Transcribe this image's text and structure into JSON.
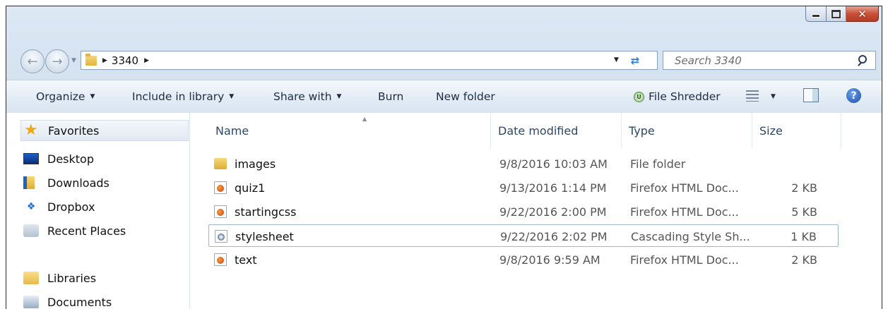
{
  "window": {
    "controls": {
      "minimize": "minimize",
      "maximize": "maximize",
      "close": "✕"
    }
  },
  "address": {
    "crumbs": [
      "3340"
    ],
    "search_placeholder": "Search 3340"
  },
  "toolbar": {
    "organize": "Organize",
    "include_in_library": "Include in library",
    "share_with": "Share with",
    "burn": "Burn",
    "new_folder": "New folder",
    "file_shredder": "File Shredder",
    "shredder_badge": "U"
  },
  "nav_pane": {
    "favorites": "Favorites",
    "items": [
      "Desktop",
      "Downloads",
      "Dropbox",
      "Recent Places"
    ],
    "libraries": "Libraries",
    "library_items": [
      "Documents"
    ]
  },
  "file_list": {
    "columns": {
      "name": "Name",
      "date": "Date modified",
      "type": "Type",
      "size": "Size"
    },
    "rows": [
      {
        "name": "images",
        "date": "9/8/2016 10:03 AM",
        "type": "File folder",
        "size": "",
        "icon": "folder-icon"
      },
      {
        "name": "quiz1",
        "date": "9/13/2016 1:14 PM",
        "type": "Firefox HTML Doc...",
        "size": "2 KB",
        "icon": "firefox-html-icon"
      },
      {
        "name": "startingcss",
        "date": "9/22/2016 2:00 PM",
        "type": "Firefox HTML Doc...",
        "size": "5 KB",
        "icon": "firefox-html-icon"
      },
      {
        "name": "stylesheet",
        "date": "9/22/2016 2:02 PM",
        "type": "Cascading Style Sh...",
        "size": "1 KB",
        "icon": "css-file-icon"
      },
      {
        "name": "text",
        "date": "9/8/2016 9:59 AM",
        "type": "Firefox HTML Doc...",
        "size": "2 KB",
        "icon": "firefox-html-icon"
      }
    ]
  },
  "colors": {
    "accent": "#2f7fd0",
    "close": "#c85138",
    "frame": "#c9d9ea"
  }
}
